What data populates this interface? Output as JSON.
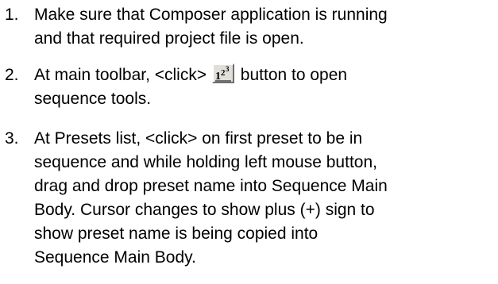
{
  "steps": [
    {
      "number": "1.",
      "lines": [
        "Make sure that Composer application is running",
        "and that required project file is open."
      ]
    },
    {
      "number": "2.",
      "line1_before": "At main toolbar, <click>",
      "line1_after": "button to open",
      "line2": "sequence tools.",
      "button_icon": "sequence-tools-icon",
      "button_label": "123"
    },
    {
      "number": "3.",
      "lines": [
        "At Presets list, <click> on first preset to be in",
        "sequence and while holding left mouse button,",
        "drag and drop preset name into Sequence Main",
        "Body. Cursor changes to show plus (+) sign to",
        "show preset name is being copied into",
        "Sequence Main Body."
      ]
    }
  ],
  "colors": {
    "text": "#000000",
    "background": "#ffffff",
    "button_face": "#e0dfd8",
    "icon_glyph": "#000000"
  }
}
